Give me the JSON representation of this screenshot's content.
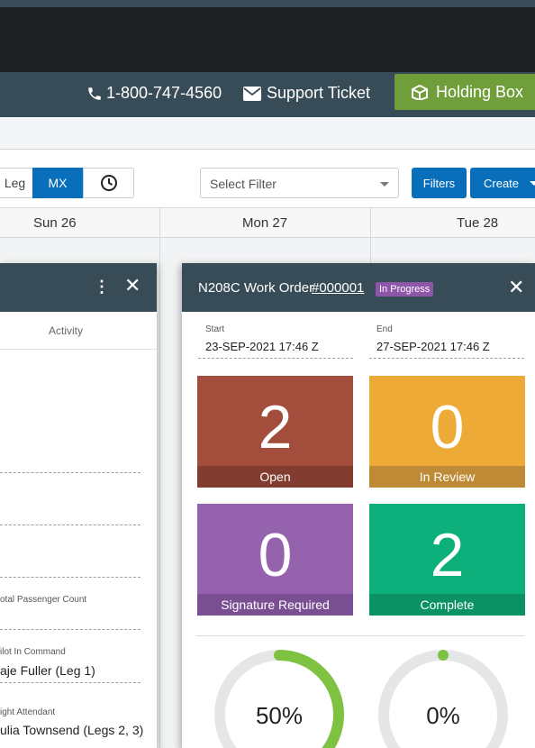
{
  "header": {
    "phone": "1-800-747-4560",
    "support": "Support Ticket",
    "holding_box": "Holding Box"
  },
  "toolbar": {
    "seg_leg": "Leg",
    "seg_mx": "MX",
    "filter_placeholder": "Select Filter",
    "filters_button": "Filters",
    "create_button": "Create"
  },
  "calendar": {
    "days": [
      "Sun 26",
      "Mon 27",
      "Tue 28"
    ]
  },
  "left_panel": {
    "tab": "Activity",
    "fields": [
      {
        "label": "otal Passenger Count",
        "value": ""
      },
      {
        "label": "ilot In Command",
        "value": "aje Fuller (Leg 1)"
      },
      {
        "label": "ight Attendant",
        "value": "ulia Townsend (Legs 2, 3)"
      }
    ]
  },
  "work_order": {
    "title": "N208C Work Order",
    "number": "#000001",
    "status": "In Progress",
    "start_label": "Start",
    "start_value": "23-SEP-2021 17:46 Z",
    "end_label": "End",
    "end_value": "27-SEP-2021 17:46 Z",
    "tiles": [
      {
        "count": "2",
        "label": "Open",
        "color": "#a34e3c",
        "foot": "#833d30"
      },
      {
        "count": "0",
        "label": "In Review",
        "color": "#eeaa36",
        "foot": "#bf8a35"
      },
      {
        "count": "0",
        "label": "Signature Required",
        "color": "#9563ad",
        "foot": "#7a4f92"
      },
      {
        "count": "2",
        "label": "Complete",
        "color": "#0db07a",
        "foot": "#0a9264"
      }
    ],
    "progress": [
      {
        "label": "50%",
        "value": 0.5,
        "color": "#7fc242"
      },
      {
        "label": "0%",
        "value": 0.0,
        "color": "#7fc242"
      }
    ]
  },
  "colors": {
    "header_bg": "#384c57",
    "primary_blue": "#0a6fba",
    "holding_green": "#6f9e3b"
  }
}
